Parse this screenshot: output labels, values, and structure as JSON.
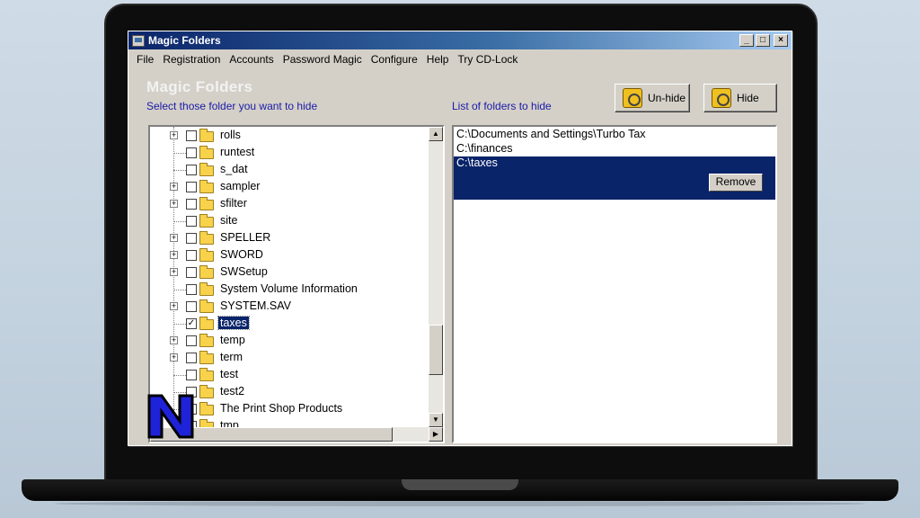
{
  "window": {
    "title": "Magic Folders",
    "controls": {
      "minimize": "_",
      "maximize": "□",
      "close": "×"
    }
  },
  "menu": [
    "File",
    "Registration",
    "Accounts",
    "Password Magic",
    "Configure",
    "Help",
    "Try CD-Lock"
  ],
  "content": {
    "heading": "Magic Folders",
    "select_label": "Select those folder you want to hide",
    "list_label": "List of folders to hide",
    "unhide_label": "Un-hide",
    "hide_label": "Hide"
  },
  "tree": [
    {
      "label": "rolls",
      "expandable": true,
      "checked": false
    },
    {
      "label": "runtest",
      "expandable": false,
      "checked": false
    },
    {
      "label": "s_dat",
      "expandable": false,
      "checked": false
    },
    {
      "label": "sampler",
      "expandable": true,
      "checked": false
    },
    {
      "label": "sfilter",
      "expandable": true,
      "checked": false
    },
    {
      "label": "site",
      "expandable": false,
      "checked": false
    },
    {
      "label": "SPELLER",
      "expandable": true,
      "checked": false
    },
    {
      "label": "SWORD",
      "expandable": true,
      "checked": false
    },
    {
      "label": "SWSetup",
      "expandable": true,
      "checked": false
    },
    {
      "label": "System Volume Information",
      "expandable": false,
      "checked": false
    },
    {
      "label": "SYSTEM.SAV",
      "expandable": true,
      "checked": false
    },
    {
      "label": "taxes",
      "expandable": false,
      "checked": true,
      "selected": true
    },
    {
      "label": "temp",
      "expandable": true,
      "checked": false
    },
    {
      "label": "term",
      "expandable": true,
      "checked": false
    },
    {
      "label": "test",
      "expandable": false,
      "checked": false
    },
    {
      "label": "test2",
      "expandable": false,
      "checked": false
    },
    {
      "label": "The Print Shop Products",
      "expandable": false,
      "checked": false
    },
    {
      "label": "tmp",
      "expandable": false,
      "checked": false
    }
  ],
  "hidden_list": [
    {
      "path": "C:\\Documents and Settings\\Turbo Tax",
      "selected": false
    },
    {
      "path": "C:\\finances",
      "selected": false
    },
    {
      "path": "C:\\taxes",
      "selected": true
    }
  ],
  "remove_label": "Remove",
  "scroll": {
    "arrow_up": "▲",
    "arrow_down": "▼",
    "arrow_right": "▶"
  },
  "logo_letter": "N"
}
